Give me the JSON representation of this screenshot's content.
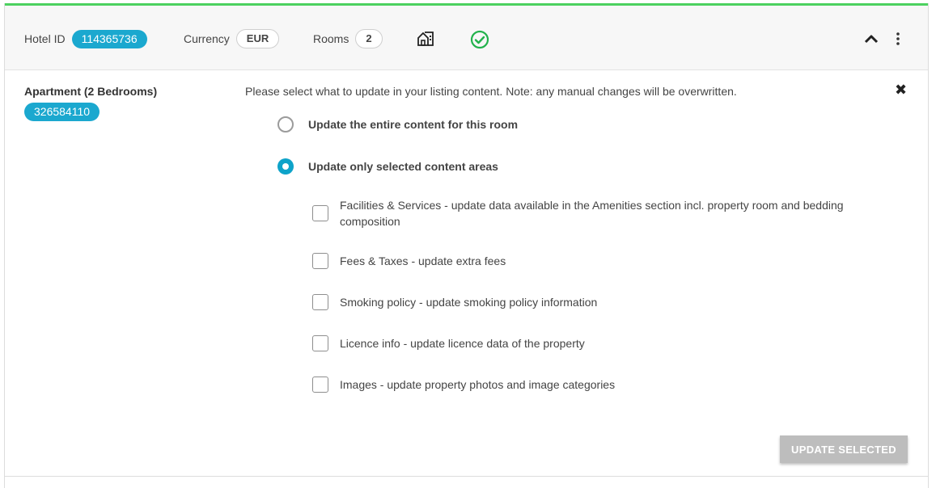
{
  "header": {
    "hotel_id_label": "Hotel ID",
    "hotel_id_value": "114365736",
    "currency_label": "Currency",
    "currency_value": "EUR",
    "rooms_label": "Rooms",
    "rooms_value": "2",
    "property_icon": "house-icon",
    "status_icon": "check-circle-icon",
    "collapse_icon": "chevron-up-icon",
    "menu_icon": "kebab-menu-icon"
  },
  "room": {
    "name": "Apartment (2 Bedrooms)",
    "id": "326584110"
  },
  "panel": {
    "note": "Please select what to update in your listing content. Note: any manual changes will be overwritten.",
    "close_symbol": "✖",
    "radio_options": [
      {
        "label": "Update the entire content for this room",
        "checked": false
      },
      {
        "label": "Update only selected content areas",
        "checked": true
      }
    ],
    "checkboxes": [
      {
        "label": "Facilities & Services - update data available in the Amenities section incl. property room and bedding composition",
        "checked": false
      },
      {
        "label": "Fees & Taxes - update extra fees",
        "checked": false
      },
      {
        "label": "Smoking policy - update smoking policy information",
        "checked": false
      },
      {
        "label": "Licence info - update licence data of the property",
        "checked": false
      },
      {
        "label": "Images - update property photos and image categories",
        "checked": false
      }
    ],
    "update_button": "UPDATE SELECTED"
  },
  "colors": {
    "accent_green": "#4cd15f",
    "accent_blue": "#1ba8cf",
    "button_disabled": "#bdbdbd"
  }
}
